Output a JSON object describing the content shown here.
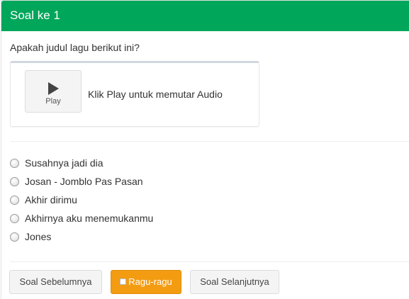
{
  "panel": {
    "title": "Soal ke 1"
  },
  "question": {
    "text": "Apakah judul lagu berikut ini?"
  },
  "audio": {
    "play_label": "Play",
    "hint": "Klik Play untuk memutar Audio"
  },
  "options": [
    {
      "label": "Susahnya jadi dia"
    },
    {
      "label": "Josan - Jomblo Pas Pasan"
    },
    {
      "label": "Akhir dirimu"
    },
    {
      "label": "Akhirnya aku menemukanmu"
    },
    {
      "label": "Jones"
    }
  ],
  "navigation": {
    "prev_label": "Soal Sebelumnya",
    "doubt_label": "Ragu-ragu",
    "next_label": "Soal Selanjutnya"
  },
  "colors": {
    "header": "#00a65a",
    "warning": "#f39c12"
  },
  "icons": {
    "play": "play-icon",
    "doubt": "checkbox-icon"
  }
}
